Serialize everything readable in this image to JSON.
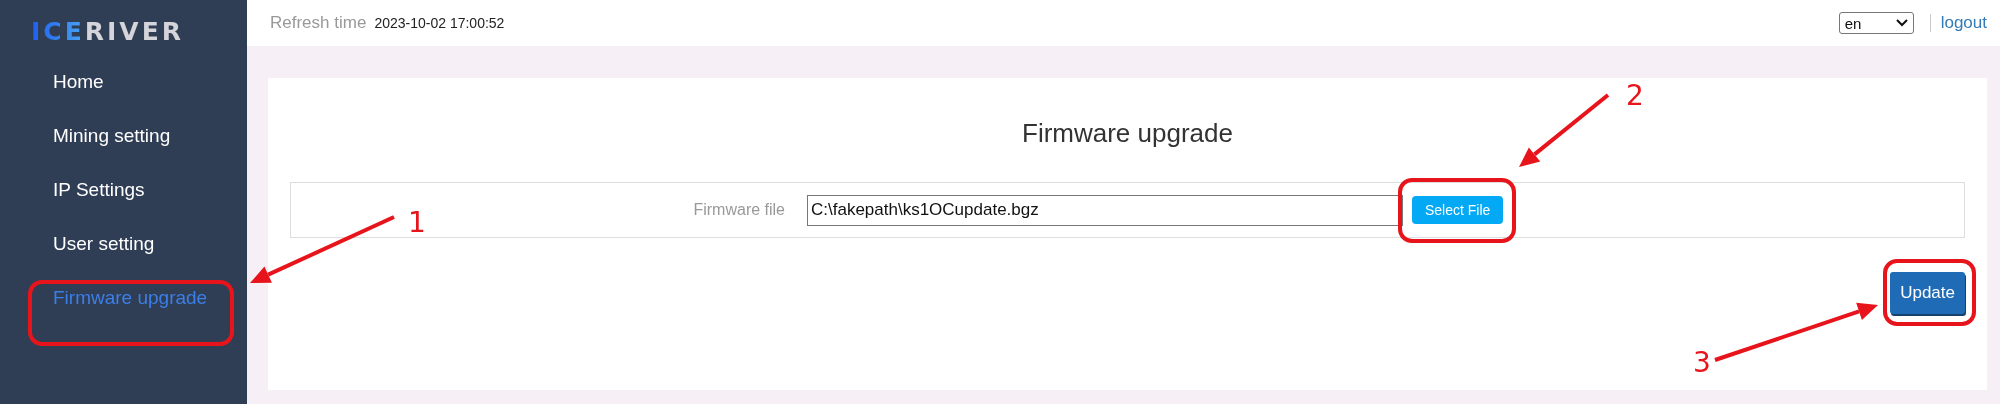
{
  "logo": "ICERIVER",
  "sidebar": {
    "items": [
      {
        "label": "Home",
        "selected": false
      },
      {
        "label": "Mining setting",
        "selected": false
      },
      {
        "label": "IP Settings",
        "selected": false
      },
      {
        "label": "User setting",
        "selected": false
      },
      {
        "label": "Firmware upgrade",
        "selected": true
      }
    ]
  },
  "top_bar": {
    "refresh_label": "Refresh time",
    "refresh_time": "2023-10-02 17:00:52",
    "language": "en",
    "logout": "logout"
  },
  "card": {
    "title": "Firmware upgrade",
    "field_label": "Firmware file",
    "field_value": "C:\\fakepath\\ks1OCupdate.bgz",
    "select_button": "Select File",
    "update_button": "Update"
  },
  "annotations": [
    {
      "number": "1"
    },
    {
      "number": "2"
    },
    {
      "number": "3"
    }
  ]
}
